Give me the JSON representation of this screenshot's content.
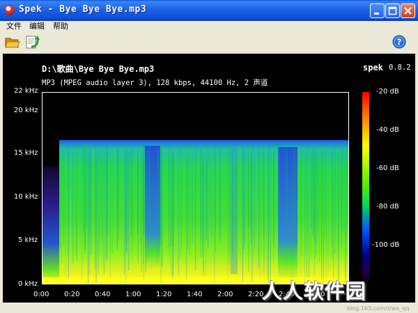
{
  "window": {
    "title": "Spek - Bye Bye Bye.mp3",
    "controls": {
      "minimize": "minimize",
      "maximize": "maximize",
      "close": "close"
    }
  },
  "menu": [
    "文件",
    "编辑",
    "帮助"
  ],
  "toolbar": {
    "open_icon": "folder-open-icon",
    "save_icon": "save-refresh-icon",
    "help_icon": "help-icon"
  },
  "header": {
    "file_path": "D:\\歌曲\\Bye Bye Bye.mp3",
    "file_info": "MP3 (MPEG audio layer 3), 128 kbps, 44100 Hz, 2 声道",
    "app_name": "spek",
    "app_version": "0.8.2"
  },
  "chart_data": {
    "type": "heatmap",
    "y_axis": {
      "ticks": [
        "22 kHz",
        "20 kHz",
        "15 kHz",
        "10 kHz",
        "5 kHz",
        "0 kHz"
      ],
      "ylim_khz": [
        0,
        22
      ]
    },
    "x_axis": {
      "ticks": [
        "0:00",
        "0:20",
        "0:40",
        "1:00",
        "1:20",
        "1:40",
        "2:00",
        "2:20",
        "2:40",
        "3:00"
      ],
      "xlim_seconds": [
        0,
        200
      ]
    },
    "colorbar": {
      "ticks": [
        "-20 dB",
        "-40 dB",
        "-60 dB",
        "-80 dB",
        "-100 dB"
      ]
    },
    "lowpass_cutoff_khz": 16,
    "colors": {
      "background": "#000000",
      "high": "#ffff00",
      "mid": "#33dd44",
      "low": "#1144ff"
    }
  },
  "watermark": {
    "text": "人人软件园",
    "url": "blog.163.com/ziwo_qq"
  }
}
